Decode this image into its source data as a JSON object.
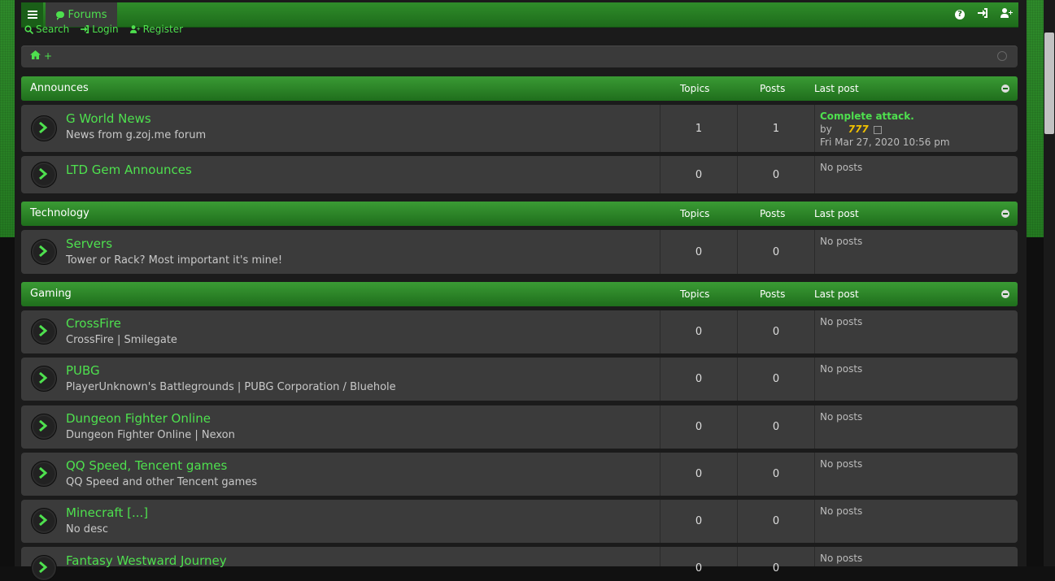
{
  "navbar": {
    "forums_label": "Forums",
    "search_label": "Search",
    "login_label": "Login",
    "register_label": "Register"
  },
  "breadcrumb": {
    "plus": "+"
  },
  "columns": {
    "topics": "Topics",
    "posts": "Posts",
    "last_post": "Last post"
  },
  "categories": [
    {
      "title": "Announces",
      "forums": [
        {
          "title": "G World News",
          "desc": "News from g.zoj.me forum",
          "topics": "1",
          "posts": "1",
          "last_post": {
            "title": "Complete attack.",
            "by": "by",
            "user": "777",
            "date": "Fri Mar 27, 2020 10:56 pm"
          }
        },
        {
          "title": "LTD Gem Announces",
          "desc": "",
          "topics": "0",
          "posts": "0",
          "no_posts": "No posts"
        }
      ]
    },
    {
      "title": "Technology",
      "forums": [
        {
          "title": "Servers",
          "desc": "Tower or Rack? Most important it's mine!",
          "topics": "0",
          "posts": "0",
          "no_posts": "No posts"
        }
      ]
    },
    {
      "title": "Gaming",
      "forums": [
        {
          "title": "CrossFire",
          "desc": "CrossFire | Smilegate",
          "topics": "0",
          "posts": "0",
          "no_posts": "No posts"
        },
        {
          "title": "PUBG",
          "desc": "PlayerUnknown's Battlegrounds | PUBG Corporation / Bluehole",
          "topics": "0",
          "posts": "0",
          "no_posts": "No posts"
        },
        {
          "title": "Dungeon Fighter Online",
          "desc": "Dungeon Fighter Online | Nexon",
          "topics": "0",
          "posts": "0",
          "no_posts": "No posts"
        },
        {
          "title": "QQ Speed, Tencent games",
          "desc": "QQ Speed and other Tencent games",
          "topics": "0",
          "posts": "0",
          "no_posts": "No posts"
        },
        {
          "title": "Minecraft [...]",
          "desc": "No desc",
          "topics": "0",
          "posts": "0",
          "no_posts": "No posts"
        },
        {
          "title": "Fantasy Westward Journey",
          "desc": "",
          "topics": "0",
          "posts": "0",
          "no_posts": "No posts"
        }
      ]
    }
  ],
  "colors": {
    "accent": "#4ee04e",
    "header_green": "#2f8d2a",
    "row_bg": "#3b3b3b",
    "username": "#f0c000"
  },
  "icons": [
    "menu-icon",
    "forums-bubble-icon",
    "help-icon",
    "login-icon",
    "register-icon",
    "search-icon",
    "home-icon",
    "clock-icon",
    "collapse-icon",
    "forum-read-icon",
    "goto-post-icon"
  ]
}
